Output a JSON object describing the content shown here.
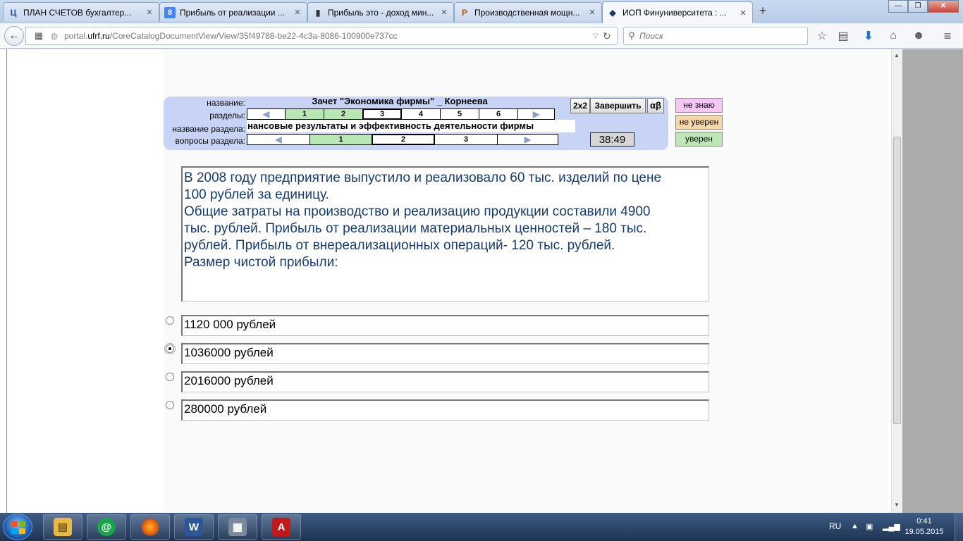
{
  "browser": {
    "tabs": [
      {
        "icon_text": "Ц",
        "icon_name": "letter-ts-site-icon",
        "icon_color": "#1d4fa0",
        "title": "ПЛАН СЧЕТОВ бухгалтер..."
      },
      {
        "icon_text": "8",
        "icon_name": "google-icon",
        "icon_color": "#4285f4",
        "title": "Прибыль от реализации ..."
      },
      {
        "icon_text": "▮",
        "icon_name": "book-icon",
        "icon_color": "#333333",
        "title": "Прибыль это - доход мин..."
      },
      {
        "icon_text": "P",
        "icon_name": "letter-p-site-icon",
        "icon_color": "#b05a1a",
        "title": "Производственная мощн..."
      },
      {
        "icon_text": "◆",
        "icon_name": "graduation-cap-icon",
        "icon_color": "#1b3a6b",
        "title": "ИОП Финуниверситета : ..."
      }
    ],
    "url_prefix": "portal.",
    "url_host": "ufrf.ru",
    "url_path": "/CoreCatalogDocumentView/View/35f49788-be22-4c3a-8086-100900e737cc",
    "search_placeholder": "Поиск"
  },
  "test": {
    "labels": {
      "name": "название:",
      "sections": "разделы:",
      "section_name": "название раздела:",
      "section_questions": "вопросы раздела:"
    },
    "title": "Зачет \"Экономика фирмы\" _ Корнеева",
    "sections": [
      {
        "label": "1",
        "state": "done"
      },
      {
        "label": "2",
        "state": "done"
      },
      {
        "label": "3",
        "state": "current"
      },
      {
        "label": "4",
        "state": "none"
      },
      {
        "label": "5",
        "state": "none"
      },
      {
        "label": "6",
        "state": "none"
      }
    ],
    "section_title": "нансовые результаты и эффективность деятельности   фирмы",
    "questions": [
      {
        "label": "1",
        "state": "done"
      },
      {
        "label": "2",
        "state": "current"
      },
      {
        "label": "3",
        "state": "none"
      }
    ],
    "buttons": {
      "grid": "2x2",
      "finish": "Завершить",
      "alpha_beta": "αβ"
    },
    "timer": "38:49",
    "confidence": {
      "dont_know": "не знаю",
      "unsure": "не уверен",
      "sure": "уверен"
    },
    "colors": {
      "done": "#b7e7b3",
      "panel": "#c7d4f5",
      "question_text": "#163c6e"
    }
  },
  "question": {
    "lines": [
      "В 2008 году предприятие выпустило и реализовало 60 тыс. изделий по цене",
      "100 рублей за единицу.",
      "Общие затраты на производство и реализацию продукции составили 4900",
      "тыс. рублей. Прибыль от реализации материальных ценностей – 180 тыс.",
      "рублей. Прибыль от внереализационных операций- 120 тыс. рублей.",
      "Размер  чистой прибыли:"
    ]
  },
  "answers": [
    {
      "text": "1120 000 рублей",
      "selected": false
    },
    {
      "text": "1036000 рублей",
      "selected": true
    },
    {
      "text": "2016000 рублей",
      "selected": false
    },
    {
      "text": "280000 рублей",
      "selected": false
    }
  ],
  "taskbar": {
    "apps": [
      {
        "icon_name": "file-explorer-icon",
        "color": "#e8b84a",
        "glyph": "▤"
      },
      {
        "icon_name": "mail-ru-agent-icon",
        "color": "#1aa34a",
        "glyph": "@"
      },
      {
        "icon_name": "firefox-icon",
        "color": "#e66000",
        "glyph": "●"
      },
      {
        "icon_name": "word-icon",
        "color": "#2b5797",
        "glyph": "W"
      },
      {
        "icon_name": "calculator-icon",
        "color": "#7a8a99",
        "glyph": "▦"
      },
      {
        "icon_name": "adobe-reader-icon",
        "color": "#c21a1a",
        "glyph": "A"
      }
    ],
    "language": "RU",
    "time": "0:41",
    "date": "19.05.2015"
  }
}
